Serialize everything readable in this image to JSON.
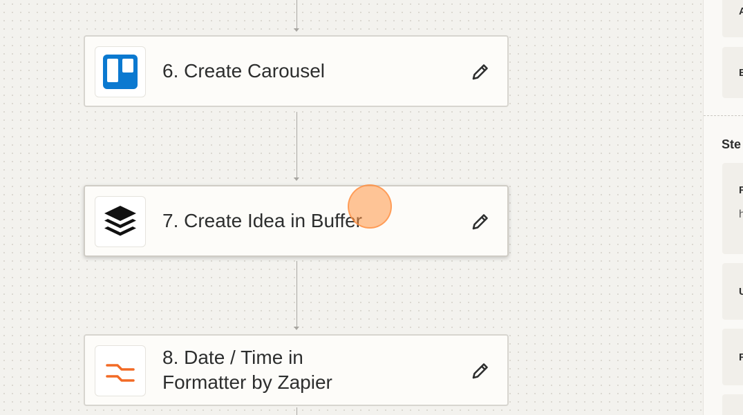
{
  "steps": [
    {
      "title": "6. Create Carousel",
      "app_icon": "trello-icon",
      "edit_icon": "pencil-icon"
    },
    {
      "title": "7. Create Idea in Buffer",
      "app_icon": "buffer-icon",
      "edit_icon": "pencil-icon"
    },
    {
      "title_line1": "8. Date / Time in",
      "title_line2": "Formatter by Zapier",
      "app_icon": "formatter-icon",
      "edit_icon": "pencil-icon"
    }
  ],
  "right_panel": {
    "items_top": [
      "A",
      "E"
    ],
    "section_heading": "Ste",
    "items_bottom": [
      {
        "letter": "F",
        "sub": "h"
      },
      {
        "letter": "U"
      },
      {
        "letter": "F"
      }
    ]
  },
  "colors": {
    "trello_blue": "#0b79d0",
    "formatter_orange": "#f26a25",
    "cursor_highlight": "#ff9646"
  }
}
